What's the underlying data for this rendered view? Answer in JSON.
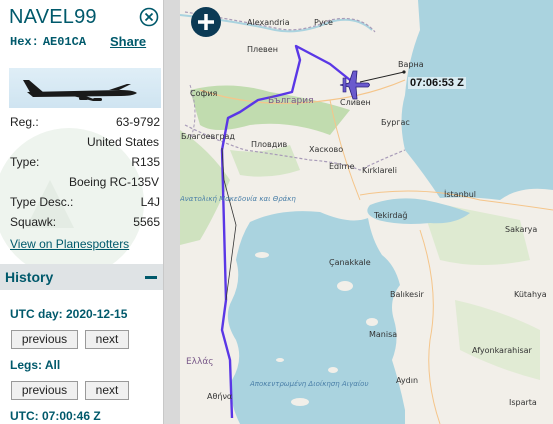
{
  "sidebar": {
    "callsign": "NAVEL99",
    "hex_label": "Hex:",
    "hex_value": "AE01CA",
    "share_label": "Share",
    "registration": {
      "label": "Reg.:",
      "value": "63-9792"
    },
    "country": "United States",
    "type": {
      "label": "Type:",
      "value": "R135"
    },
    "type_name": "Boeing RC-135V",
    "type_desc": {
      "label": "Type Desc.:",
      "value": "L4J"
    },
    "squawk": {
      "label": "Squawk:",
      "value": "5565"
    },
    "planespotters_link": "View on Planespotters",
    "icons": {
      "close": "close-circle-icon",
      "aircraft_photo": "aircraft-silhouette-icon"
    }
  },
  "history": {
    "title": "History",
    "collapse_icon": "minus-icon",
    "utc_day_label": "UTC day: 2020-12-15",
    "legs_label": "Legs: All",
    "utc_label": "UTC: 07:00:46 Z",
    "previous_label": "previous",
    "next_label": "next"
  },
  "map": {
    "zoom_icon": "plus-icon",
    "aircraft_icon": "airplane-icon",
    "time_label": "07:06:53 Z",
    "track_color": "#5a37e6",
    "aircraft_color": "#6a5acd",
    "labels": {
      "alexandria": "Alexandria",
      "ruse": "Русе",
      "pleven": "Плевен",
      "varna": "Варна",
      "sofia": "София",
      "bulgaria": "България",
      "sliven": "Сливен",
      "burgas": "Бургас",
      "blagoevgrad": "Благоевград",
      "plovdiv": "Пловдив",
      "haskovo": "Хасково",
      "edirne": "Edirne",
      "kirklareli": "Kırklareli",
      "istanbul": "İstanbul",
      "tekirdag": "Tekirdağ",
      "sakarya": "Sakarya",
      "canakkale": "Çanakkale",
      "balikesir": "Balıkesir",
      "manisa": "Manisa",
      "aydin": "Aydın",
      "isparta": "Isparta",
      "afyonkarahisar": "Afyonkarahisar",
      "kutahya": "Kütahya",
      "ellada": "Ελλάς",
      "athina": "Αθήνα",
      "macedonia": "Ανατολική Μακεδονία και Θράκη",
      "aegean": "Αποκεντρωμένη Διοίκηση Αιγαίου"
    }
  }
}
